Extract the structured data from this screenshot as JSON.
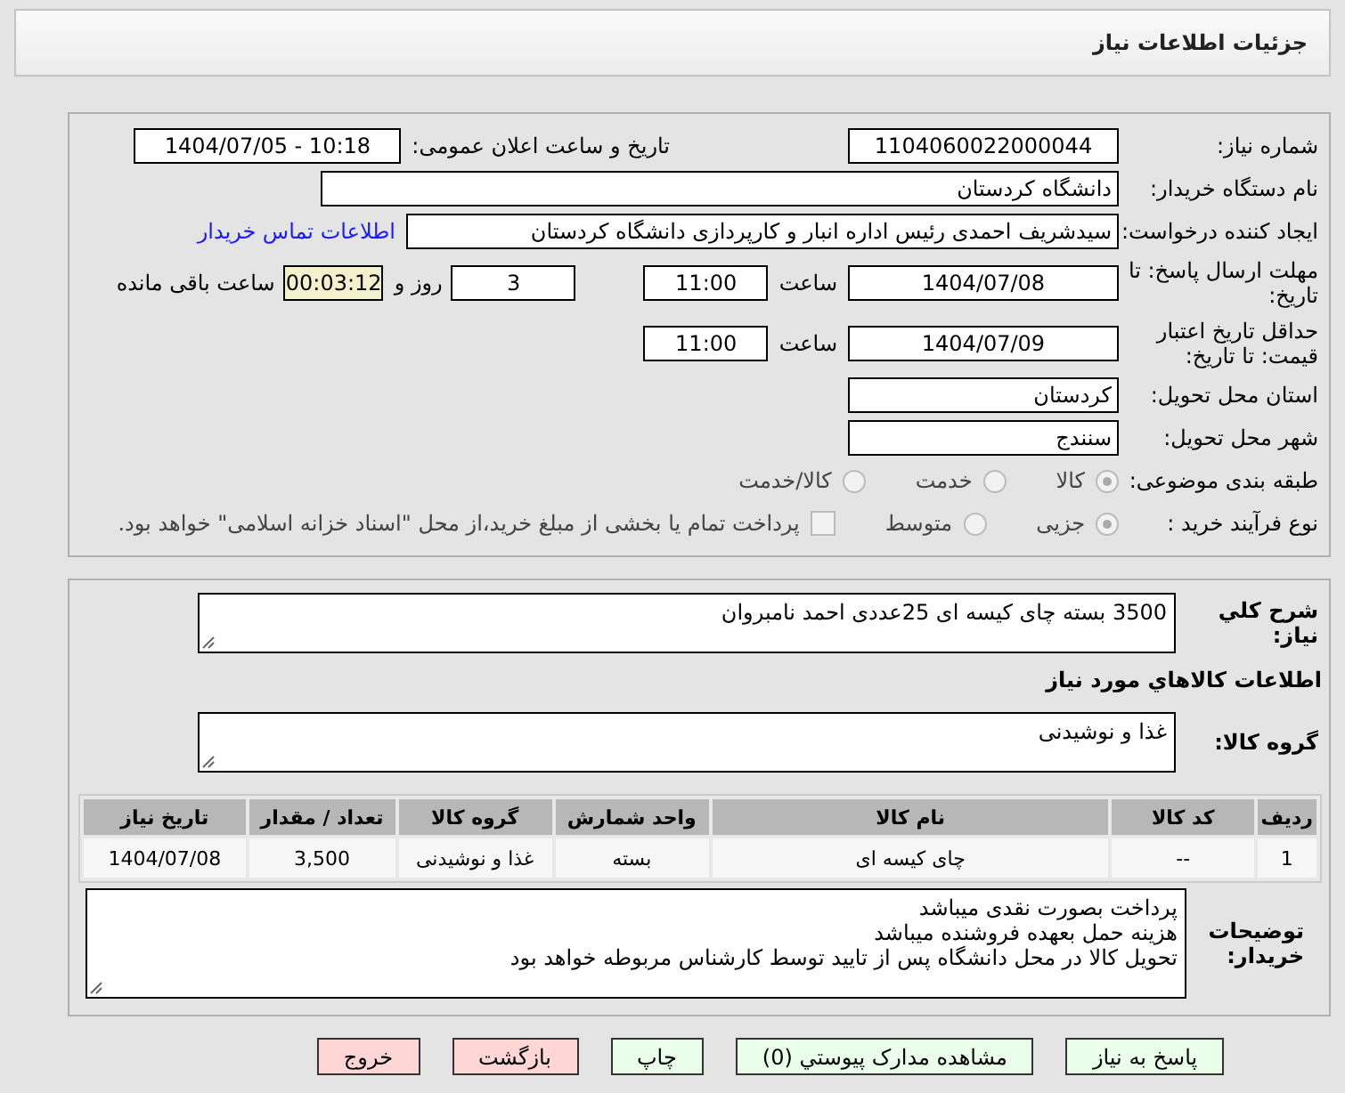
{
  "header": {
    "title": "جزئیات اطلاعات نیاز"
  },
  "need_number": {
    "label": "شماره نیاز:",
    "value": "1104060022000044"
  },
  "announce": {
    "label": "تاریخ و ساعت اعلان عمومی:",
    "value": "1404/07/05 - 10:18"
  },
  "buyer": {
    "label": "نام دستگاه خریدار:",
    "value": "دانشگاه کردستان"
  },
  "creator": {
    "label": "ایجاد کننده درخواست:",
    "value": "سیدشریف احمدی رئیس اداره انبار و کارپردازی دانشگاه کردستان",
    "link": "اطلاعات تماس خریدار"
  },
  "deadline": {
    "label": "مهلت ارسال پاسخ: تا تاریخ:",
    "date": "1404/07/08",
    "time_label": "ساعت",
    "time": "11:00",
    "days": "3",
    "days_label": "روز و",
    "remaining": "00:03:12",
    "remaining_label": "ساعت باقی مانده"
  },
  "validity": {
    "label": "حداقل تاریخ اعتبار قیمت: تا تاریخ:",
    "date": "1404/07/09",
    "time_label": "ساعت",
    "time": "11:00"
  },
  "province": {
    "label": "استان محل تحویل:",
    "value": "کردستان"
  },
  "city": {
    "label": "شهر محل تحویل:",
    "value": "سنندج"
  },
  "category": {
    "label": "طبقه بندی موضوعی:",
    "options": [
      {
        "label": "کالا",
        "selected": true
      },
      {
        "label": "خدمت",
        "selected": false
      },
      {
        "label": "کالا/خدمت",
        "selected": false
      }
    ]
  },
  "process": {
    "label": "نوع فرآیند خرید :",
    "options": [
      {
        "label": "جزیی",
        "selected": true
      },
      {
        "label": "متوسط",
        "selected": false
      }
    ],
    "checkbox": {
      "label": "پرداخت تمام یا بخشی از مبلغ خرید،از محل \"اسناد خزانه اسلامی\" خواهد بود.",
      "checked": false
    }
  },
  "description": {
    "label": "شرح کلي نياز:",
    "value": "3500 بسته چای کیسه ای 25عددی احمد نامبروان"
  },
  "items_heading": "اطلاعات کالاهاي مورد نياز",
  "group": {
    "label": "گروه کالا:",
    "value": "غذا و نوشیدنی"
  },
  "table": {
    "columns": [
      "ردیف",
      "کد کالا",
      "نام کالا",
      "واحد شمارش",
      "گروه کالا",
      "تعداد / مقدار",
      "تاریخ نیاز"
    ],
    "rows": [
      [
        "1",
        "--",
        "چای کیسه ای",
        "بسته",
        "غذا و نوشیدنی",
        "3,500",
        "1404/07/08"
      ]
    ]
  },
  "notes": {
    "label": "توضیحات خریدار:",
    "lines": [
      "پرداخت بصورت نقدی میباشد",
      "هزینه حمل بعهده فروشنده میباشد",
      "تحویل کالا در محل دانشگاه پس از تایید توسط کارشناس مربوطه خواهد بود"
    ]
  },
  "buttons": [
    {
      "label": "پاسخ به نیاز",
      "kind": "action"
    },
    {
      "label": "مشاهده مدارک پیوستي (0)",
      "kind": "action"
    },
    {
      "label": "چاپ",
      "kind": "action"
    },
    {
      "label": "بازگشت",
      "kind": "exit"
    },
    {
      "label": "خروج",
      "kind": "exit"
    }
  ]
}
